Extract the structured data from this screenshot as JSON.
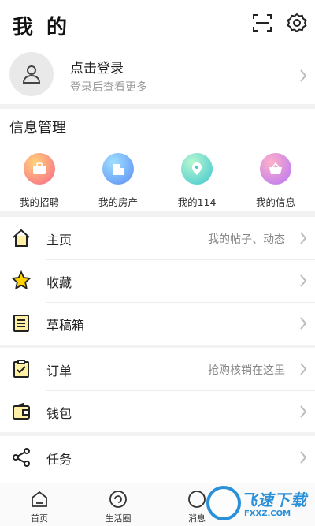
{
  "header": {
    "title": "我 的",
    "scan_icon": "scan-icon",
    "settings_icon": "gear-icon"
  },
  "profile": {
    "login_title": "点击登录",
    "login_subtitle": "登录后查看更多"
  },
  "info": {
    "title": "信息管理",
    "items": [
      {
        "label": "我的招聘",
        "icon": "briefcase-icon",
        "color": "#f7658a"
      },
      {
        "label": "我的房产",
        "icon": "building-icon",
        "color": "#5b8cf5"
      },
      {
        "label": "我的114",
        "icon": "pin-icon",
        "color": "#3fc6d0"
      },
      {
        "label": "我的信息",
        "icon": "basket-icon",
        "color": "#b575f5"
      }
    ]
  },
  "menu1": [
    {
      "label": "主页",
      "hint": "我的帖子、动态",
      "icon": "home-icon"
    },
    {
      "label": "收藏",
      "hint": "",
      "icon": "star-icon"
    },
    {
      "label": "草稿箱",
      "hint": "",
      "icon": "draft-icon"
    }
  ],
  "menu2": [
    {
      "label": "订单",
      "hint": "抢购核销在这里",
      "icon": "order-icon"
    },
    {
      "label": "钱包",
      "hint": "",
      "icon": "wallet-icon"
    }
  ],
  "menu3": [
    {
      "label": "任务",
      "hint": "",
      "icon": "share-icon"
    }
  ],
  "tabbar": [
    {
      "label": "首页",
      "icon": "home-tab-icon"
    },
    {
      "label": "生活圈",
      "icon": "life-circle-icon"
    },
    {
      "label": "消息",
      "icon": "message-icon"
    }
  ],
  "watermark": {
    "text": "飞速下载",
    "url": "FXXZ.COM"
  },
  "colors": {
    "accent_yellow": "#ffd400",
    "chevron": "#bbbbbb"
  }
}
